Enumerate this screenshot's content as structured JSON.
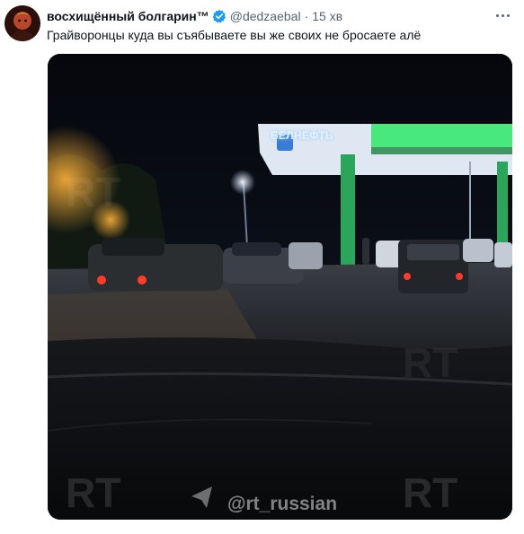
{
  "tweet": {
    "display_name": "восхищённый болгарин™",
    "handle": "@dedzaebal",
    "separator": "·",
    "time": "15 хв",
    "text": "Грайворонцы куда вы съябываете вы же своих не бросаете алё"
  },
  "media": {
    "station_sign": "БЕЛНЕФТЬ",
    "watermark": "@rt_russian",
    "channel_logo": "RT"
  },
  "colors": {
    "verified": "#1d9bf0",
    "secondary_text": "#536471",
    "primary_text": "#0f1419",
    "station_green": "#2ee86b"
  }
}
